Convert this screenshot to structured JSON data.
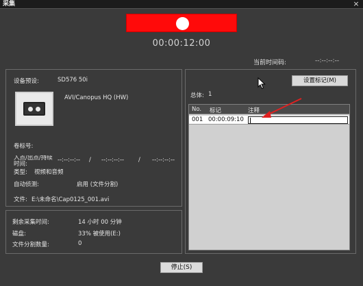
{
  "window": {
    "title": "采集",
    "close_glyph": "×"
  },
  "record": {
    "timecode": "00:00:12:00"
  },
  "current_timecode": {
    "label": "当前时间码:",
    "value": "--:--:--:--"
  },
  "device": {
    "preset_label": "设备预设:",
    "preset_value": "SD576 50i",
    "codec": "AVI/Canopus HQ (HW)",
    "reel_label": "卷标号:",
    "inout_label": "入点/出点/持续时间:",
    "in_value": "--:--:--:--",
    "sep1": "/",
    "out_value": "--:--:--:--",
    "sep2": "/",
    "dur_value": "--:--:--:--",
    "type_label": "类型:",
    "type_value": "视频和音频",
    "autodetect_label": "自动侦测:",
    "autodetect_value": "启用 (文件分割)",
    "file_label": "文件:",
    "file_value": "E:\\未命名\\Cap0125_001.avi"
  },
  "stats": {
    "remain_label": "剩余采集时间:",
    "remain_value": "14 小时 00 分钟",
    "disk_label": "磁盘:",
    "disk_value": "33% 被使用(E:)",
    "split_label": "文件分割数量:",
    "split_value": "0"
  },
  "marks": {
    "total_label": "总体:",
    "total_value": "1",
    "set_mark_button": "设置标记(M)",
    "columns": [
      "No.",
      "标记",
      "注释"
    ],
    "rows": [
      {
        "no": "001",
        "mark": "00:00:09:10",
        "note": ""
      }
    ]
  },
  "footer": {
    "stop_button": "停止(S)"
  },
  "colors": {
    "record_red": "#ff0a0a",
    "background": "#3a3a3a",
    "annotation_arrow": "#e02020"
  }
}
